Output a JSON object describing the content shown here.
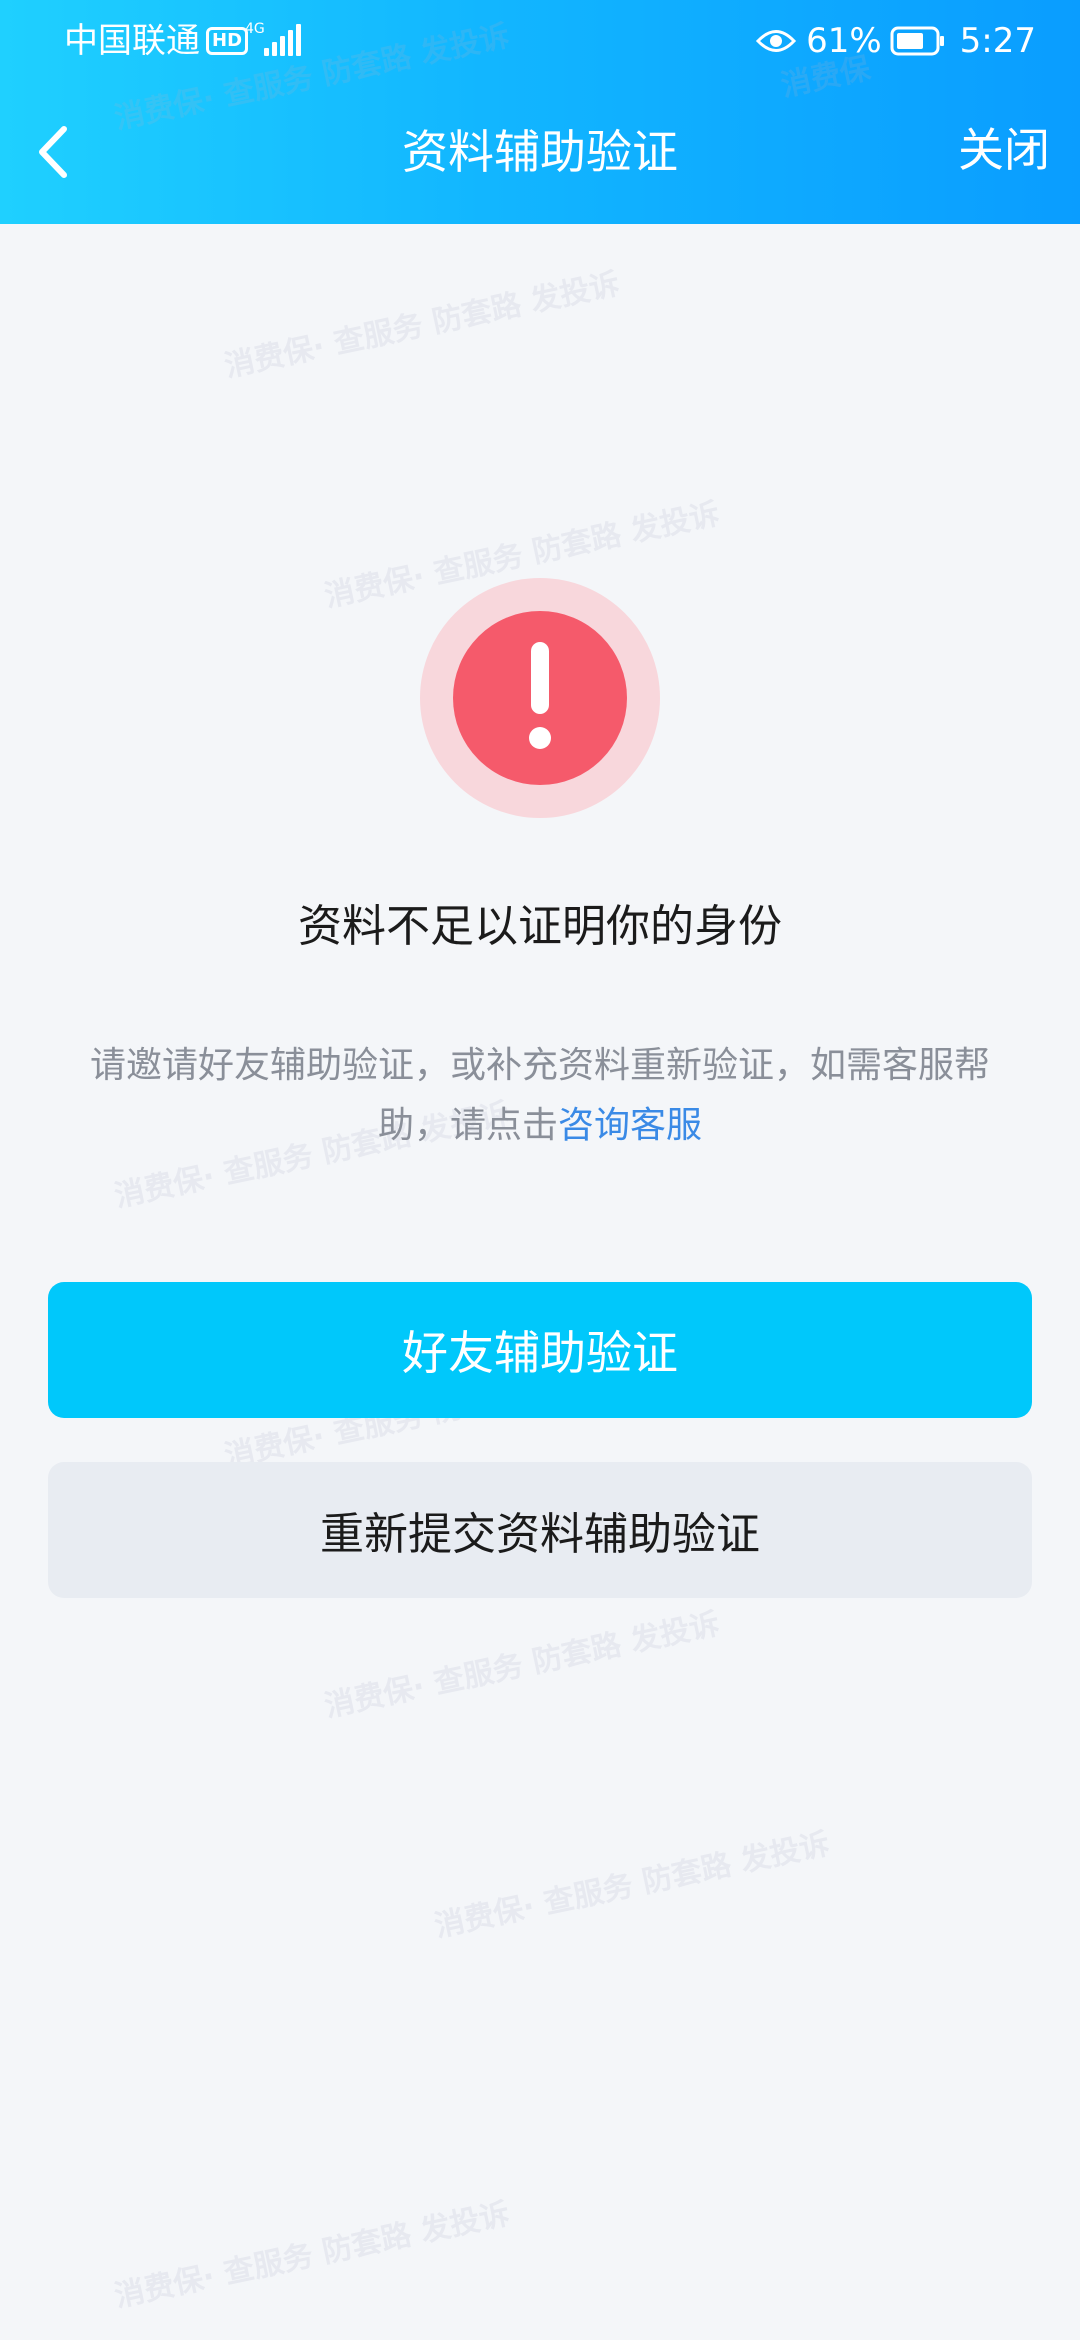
{
  "status_bar": {
    "carrier": "中国联通",
    "hd_badge": "HD",
    "network": "4G",
    "battery_percent": "61%",
    "time": "5:27"
  },
  "nav": {
    "title": "资料辅助验证",
    "close_label": "关闭"
  },
  "watermark": {
    "brand": "消费保",
    "slogan": "· 查服务 防套路 发投诉"
  },
  "main": {
    "headline": "资料不足以证明你的身份",
    "description": "请邀请好友辅助验证，或补充资料重新验证，如需客服帮助，请点击",
    "link_text": "咨询客服"
  },
  "buttons": {
    "primary_label": "好友辅助验证",
    "secondary_label": "重新提交资料辅助验证"
  },
  "colors": {
    "header_start": "#1fd0ff",
    "header_end": "#0a9dff",
    "primary": "#00c8fb",
    "alert": "#f55a6b",
    "link": "#3a8ae6"
  }
}
